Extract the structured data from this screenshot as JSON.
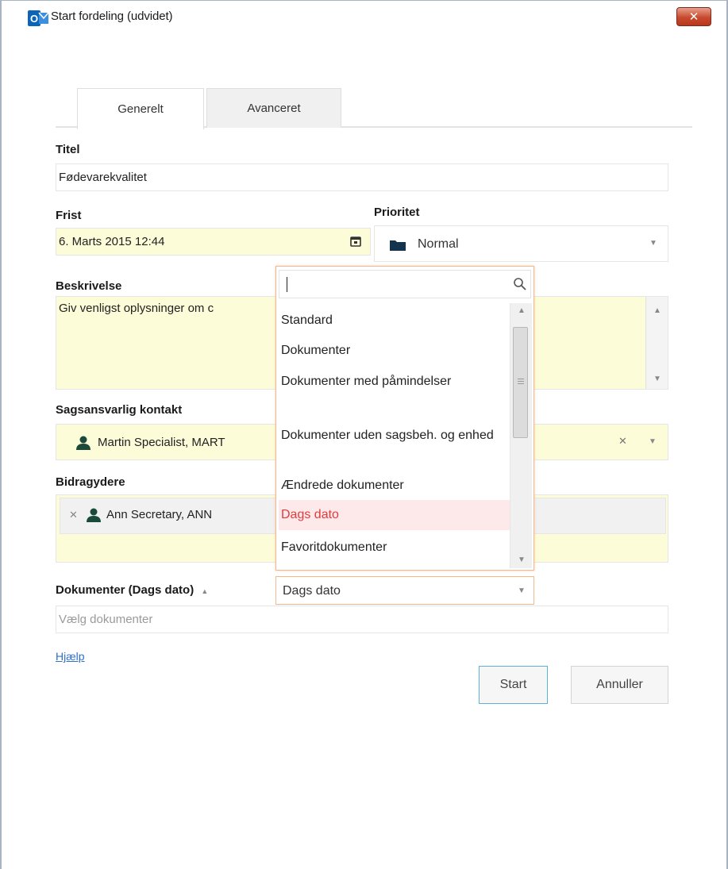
{
  "window": {
    "title": "Start fordeling (udvidet)",
    "close_glyph": "✕"
  },
  "tabs": [
    {
      "label": "Generelt",
      "active": true
    },
    {
      "label": "Avanceret",
      "active": false
    }
  ],
  "form": {
    "titel_label": "Titel",
    "titel_value": "Fødevarekvalitet",
    "frist_label": "Frist",
    "frist_value": "6. Marts 2015 12:44",
    "prioritet_label": "Prioritet",
    "prioritet_value": "Normal",
    "beskrivelse_label": "Beskrivelse",
    "beskrivelse_value": "Giv venligst oplysninger om c",
    "sagsansvarlig_label": "Sagsansvarlig kontakt",
    "sagsansvarlig_value": "Martin Specialist, MART",
    "bidragydere_label": "Bidragydere",
    "bidragydere_value": "Ann Secretary, ANN",
    "dokumenter_label": "Dokumenter (Dags dato)",
    "dokumenter_sort_glyph": "▲",
    "dokumenter_filter_value": "Dags dato",
    "dokumenter_placeholder": "Vælg dokumenter",
    "help_link": "Hjælp",
    "remove_glyph": "✕"
  },
  "popup": {
    "search_value": "",
    "items": [
      {
        "label": "Standard"
      },
      {
        "label": "Dokumenter"
      },
      {
        "label": "Dokumenter med påmindelser"
      },
      {
        "label": "Dokumenter uden sagsbeh. og enhed"
      },
      {
        "label": "Ændrede dokumenter"
      },
      {
        "label": "Dags dato",
        "selected": true
      },
      {
        "label": "Favoritdokumenter"
      }
    ]
  },
  "buttons": {
    "start": "Start",
    "annuller": "Annuller"
  },
  "colors": {
    "accent_yellow": "#fdfcd9",
    "selected_text": "#e23b3b",
    "selected_bg": "#fde9ea",
    "link": "#2f6fc9",
    "close_red": "#c84a2e"
  }
}
